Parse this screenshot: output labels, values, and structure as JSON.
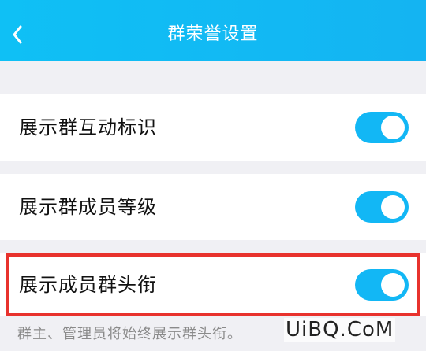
{
  "header": {
    "title": "群荣誉设置",
    "back_icon": "chevron-left-icon",
    "background": "#13b9f4"
  },
  "settings": [
    {
      "label": "展示群互动标识",
      "enabled": true
    },
    {
      "label": "展示群成员等级",
      "enabled": true
    },
    {
      "label": "展示成员群头衔",
      "enabled": true
    }
  ],
  "footnote": "群主、管理员将始终展示群头衔。",
  "watermark": "UiBQ.CoM",
  "colors": {
    "toggle_on": "#12b7f5",
    "highlight": "#e8322d"
  }
}
